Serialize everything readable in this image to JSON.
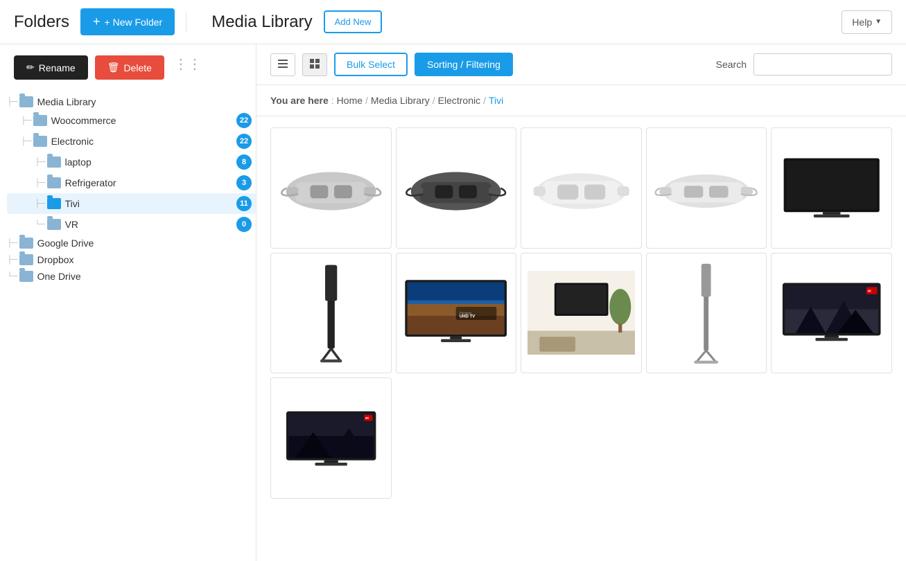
{
  "header": {
    "folders_title": "Folders",
    "btn_new_folder": "+ New Folder",
    "media_library_title": "Media Library",
    "btn_add_new": "Add New",
    "btn_help": "Help"
  },
  "sidebar": {
    "btn_rename": "Rename",
    "btn_delete": "Delete",
    "tree": [
      {
        "id": "media-library",
        "label": "Media Library",
        "level": 0,
        "count": null,
        "selected": false
      },
      {
        "id": "woocommerce",
        "label": "Woocommerce",
        "level": 1,
        "count": "22",
        "selected": false
      },
      {
        "id": "electronic",
        "label": "Electronic",
        "level": 1,
        "count": "22",
        "selected": false
      },
      {
        "id": "laptop",
        "label": "laptop",
        "level": 2,
        "count": "8",
        "selected": false
      },
      {
        "id": "refrigerator",
        "label": "Refrigerator",
        "level": 2,
        "count": "3",
        "selected": false
      },
      {
        "id": "tivi",
        "label": "Tivi",
        "level": 2,
        "count": "11",
        "selected": true
      },
      {
        "id": "vr",
        "label": "VR",
        "level": 2,
        "count": "0",
        "selected": false
      },
      {
        "id": "google-drive",
        "label": "Google Drive",
        "level": 0,
        "count": null,
        "selected": false
      },
      {
        "id": "dropbox",
        "label": "Dropbox",
        "level": 0,
        "count": null,
        "selected": false
      },
      {
        "id": "one-drive",
        "label": "One Drive",
        "level": 0,
        "count": null,
        "selected": false
      }
    ]
  },
  "toolbar": {
    "btn_bulk_select": "Bulk Select",
    "btn_sorting": "Sorting / Filtering",
    "search_label": "Search"
  },
  "breadcrumb": {
    "you_are_here": "You are here",
    "path": [
      "Home",
      "Media Library",
      "Electronic",
      "Tivi"
    ]
  },
  "media_items": [
    {
      "id": 1,
      "type": "vr_headset",
      "color": "#ccc"
    },
    {
      "id": 2,
      "type": "vr_headset_dark",
      "color": "#555"
    },
    {
      "id": 3,
      "type": "vr_headset_white",
      "color": "#eee"
    },
    {
      "id": 4,
      "type": "vr_headset_white2",
      "color": "#ddd"
    },
    {
      "id": 5,
      "type": "tv_black",
      "color": "#111"
    },
    {
      "id": 6,
      "type": "thin_tv_black",
      "color": "#222"
    },
    {
      "id": 7,
      "type": "uhd_tv",
      "color": "#1a5fa8"
    },
    {
      "id": 8,
      "type": "room_tv",
      "color": "#888"
    },
    {
      "id": 9,
      "type": "thin_tv_white",
      "color": "#888"
    },
    {
      "id": 10,
      "type": "curved_tv",
      "color": "#aaa"
    },
    {
      "id": 11,
      "type": "tv_landscape_small",
      "color": "#444"
    }
  ]
}
